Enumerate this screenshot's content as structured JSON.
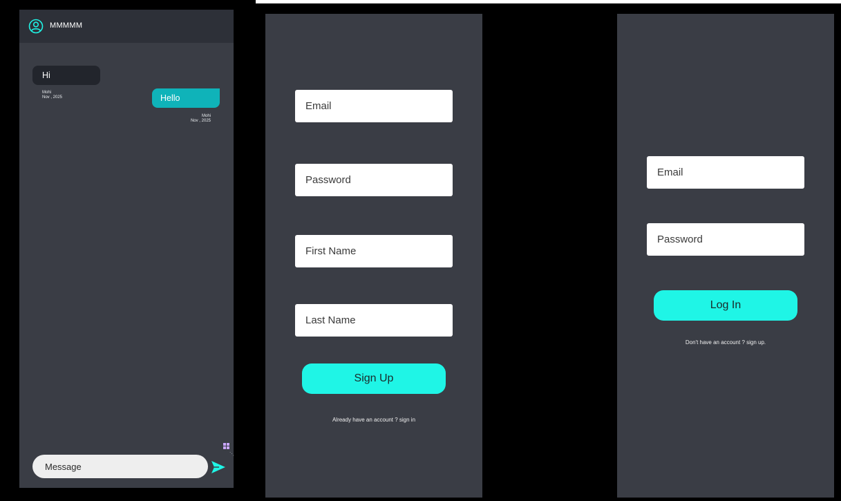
{
  "chat": {
    "contact_name": "MMMMM",
    "messages": [
      {
        "direction": "incoming",
        "text": "Hi",
        "sender": "Mohi",
        "date": "Nov , 2025"
      },
      {
        "direction": "outgoing",
        "text": "Hello",
        "sender": "Mohi",
        "date": "Nov , 2025"
      }
    ],
    "input_placeholder": "Message",
    "icons": [
      "user-circle-icon",
      "grid-icon",
      "send-icon"
    ]
  },
  "signup": {
    "email_placeholder": "Email",
    "password_placeholder": "Password",
    "first_name_placeholder": "First Name",
    "last_name_placeholder": "Last Name",
    "submit_label": "Sign Up",
    "footer_text": "Already have an account ? sign in"
  },
  "login": {
    "email_placeholder": "Email",
    "password_placeholder": "Password",
    "submit_label": "Log In",
    "footer_text": "Don't have an account ? sign up."
  },
  "colors": {
    "panel_bg": "#3a3d45",
    "header_bg": "#2d3038",
    "accent_cyan": "#1ff5e6",
    "outgoing_bubble": "#0fb3b9",
    "incoming_bubble": "#22252c"
  }
}
